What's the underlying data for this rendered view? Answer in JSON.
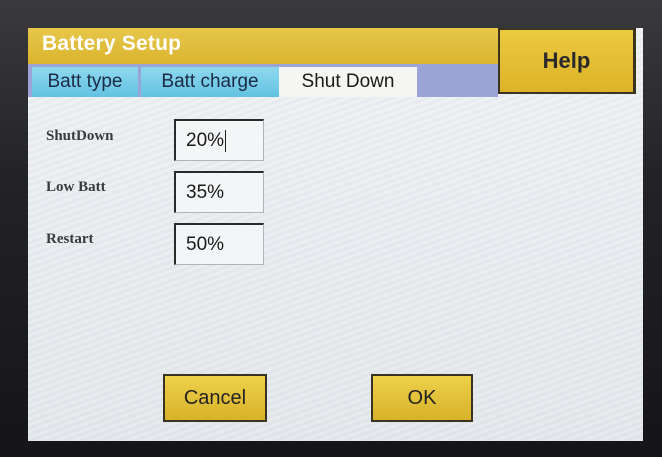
{
  "window": {
    "title": "Battery Setup",
    "help_label": "Help"
  },
  "tabs": [
    {
      "label": "Batt type",
      "active": false
    },
    {
      "label": "Batt charge",
      "active": false
    },
    {
      "label": "Shut Down",
      "active": true
    }
  ],
  "fields": [
    {
      "label": "ShutDown",
      "value": "20%",
      "focused": true
    },
    {
      "label": "Low Batt",
      "value": "35%",
      "focused": false
    },
    {
      "label": "Restart",
      "value": "50%",
      "focused": false
    }
  ],
  "buttons": {
    "cancel_label": "Cancel",
    "ok_label": "OK"
  },
  "colors": {
    "title_bar": "#d9b42e",
    "button_yellow": "#e6c23a",
    "tab_inactive": "#62c2e2",
    "tab_row_bg": "#9aa4d6"
  }
}
